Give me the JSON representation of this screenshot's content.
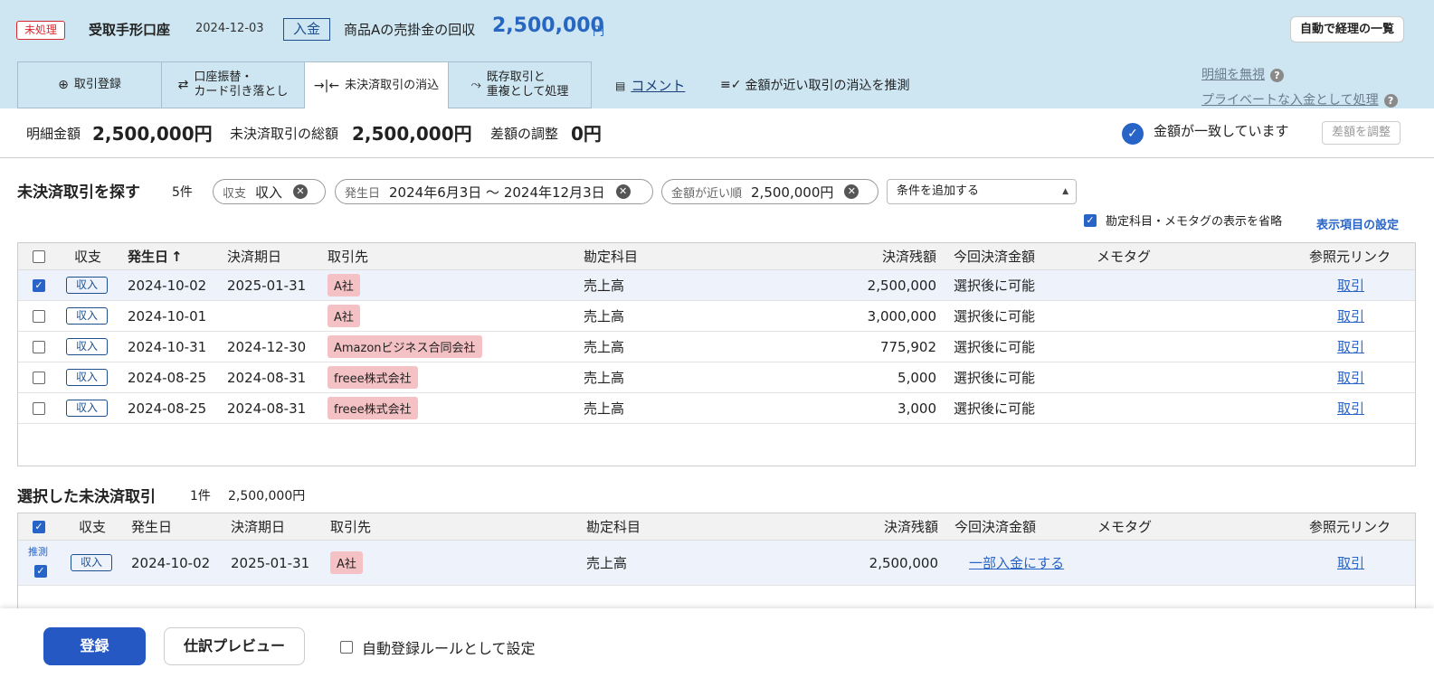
{
  "header": {
    "status": "未処理",
    "account": "受取手形口座",
    "date": "2024-12-03",
    "type": "入金",
    "description": "商品Aの売掛金の回収",
    "amount": "2,500,000",
    "currency": "円",
    "auto_button": "自動で経理の一覧"
  },
  "tabs": [
    {
      "label": "取引登録",
      "icon": "plus-circle-icon"
    },
    {
      "label": "口座振替・\nカード引き落とし",
      "icon": "transfer-icon"
    },
    {
      "label": "未決済取引の消込",
      "icon": "merge-icon"
    },
    {
      "label": "既存取引と\n重複として処理",
      "icon": "merge-arrow-icon"
    }
  ],
  "comment": "コメント",
  "guess": "金額が近い取引の消込を推測",
  "ignore": "明細を無視",
  "private": "プライベートな入金として処理",
  "summary": {
    "stmt_label": "明細金額",
    "stmt_value": "2,500,000円",
    "unsettled_label": "未決済取引の総額",
    "unsettled_value": "2,500,000円",
    "diff_label": "差額の調整",
    "diff_value": "0円",
    "match": "金額が一致しています",
    "adjust": "差額を調整"
  },
  "search": {
    "title": "未決済取引を探す",
    "count": "5件",
    "chip1_key": "収支",
    "chip1_val": "収入",
    "chip2_key": "発生日",
    "chip2_val": "2024年6月3日 〜 2024年12月3日",
    "chip3_key": "金額が近い順",
    "chip3_val": "2,500,000円",
    "add_cond": "条件を追加する",
    "omit": "勘定科目・メモタグの表示を省略",
    "display_settings": "表示項目の設定"
  },
  "columns": {
    "kind": "収支",
    "date": "発生日",
    "due": "決済期日",
    "partner": "取引先",
    "account": "勘定科目",
    "balance": "決済残額",
    "current": "今回決済金額",
    "memo": "メモタグ",
    "ref": "参照元リンク",
    "sort": "↑"
  },
  "rows": [
    {
      "kind": "収入",
      "date": "2024-10-02",
      "due": "2025-01-31",
      "partner": "A社",
      "account": "売上高",
      "balance": "2,500,000",
      "current": "選択後に可能",
      "ref": "取引",
      "checked": true
    },
    {
      "kind": "収入",
      "date": "2024-10-01",
      "due": "",
      "partner": "A社",
      "account": "売上高",
      "balance": "3,000,000",
      "current": "選択後に可能",
      "ref": "取引",
      "checked": false
    },
    {
      "kind": "収入",
      "date": "2024-10-31",
      "due": "2024-12-30",
      "partner": "Amazonビジネス合同会社",
      "account": "売上高",
      "balance": "775,902",
      "current": "選択後に可能",
      "ref": "取引",
      "checked": false
    },
    {
      "kind": "収入",
      "date": "2024-08-25",
      "due": "2024-08-31",
      "partner": "freee株式会社",
      "account": "売上高",
      "balance": "5,000",
      "current": "選択後に可能",
      "ref": "取引",
      "checked": false
    },
    {
      "kind": "収入",
      "date": "2024-08-25",
      "due": "2024-08-31",
      "partner": "freee株式会社",
      "account": "売上高",
      "balance": "3,000",
      "current": "選択後に可能",
      "ref": "取引",
      "checked": false
    }
  ],
  "selected": {
    "title": "選択した未決済取引",
    "count": "1件",
    "total": "2,500,000円",
    "row": {
      "guess": "推測",
      "kind": "収入",
      "date": "2024-10-02",
      "due": "2025-01-31",
      "partner": "A社",
      "account": "売上高",
      "balance": "2,500,000",
      "current": "一部入金にする",
      "ref": "取引"
    }
  },
  "footer": {
    "register": "登録",
    "preview": "仕訳プレビュー",
    "rule": "自動登録ルールとして設定"
  }
}
